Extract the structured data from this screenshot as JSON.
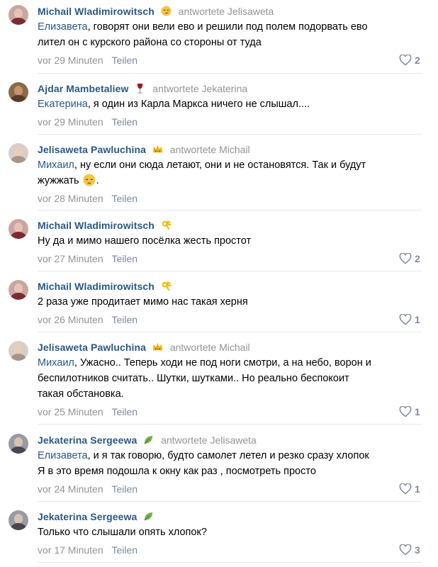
{
  "comments": [
    {
      "author": "Michail Wladimirowitsch",
      "emoji": "smirk-emoji",
      "reply_to": "antwortete Jelisaweta",
      "addressee": "Елизавета",
      "line1": ", говорят они вели ево и решили под полем подорвать ево",
      "line2": "лител он с курского района со стороны от туда",
      "time": "vor 29 Minuten",
      "share": "Teilen",
      "likes": "2"
    },
    {
      "author": "Ajdar Mambetaliew",
      "emoji": "wine-glass-emoji",
      "reply_to": "antwortete Jekaterina",
      "addressee": "Екатерина",
      "line1": ", я один из Карла Маркса ничего не слышал....",
      "time": "vor 29 Minuten",
      "share": "Teilen",
      "likes": ""
    },
    {
      "author": "Jelisaweta Pawluchina",
      "emoji": "crown-emoji",
      "reply_to": "antwortete Michail",
      "addressee": "Михаил",
      "line1": ", ну если они сюда летают, они и не остановятся. Так и будут",
      "line2": "жужжать",
      "line2_end": ".",
      "time": "vor 28 Minuten",
      "share": "Teilen",
      "likes": ""
    },
    {
      "author": "Michail Wladimirowitsch",
      "emoji": "ok-hand-emoji",
      "line1": "Ну да и мимо нашего посёлка жесть простот",
      "time": "vor 27 Minuten",
      "share": "Teilen",
      "likes": "2"
    },
    {
      "author": "Michail Wladimirowitsch",
      "emoji": "ok-hand-emoji",
      "line1": "2 раза уже продитает мимо нас такая херня",
      "time": "vor 26 Minuten",
      "share": "Teilen",
      "likes": "1"
    },
    {
      "author": "Jelisaweta Pawluchina",
      "emoji": "crown-emoji",
      "reply_to": "antwortete Michail",
      "addressee": "Михаил",
      "line1": ", Ужасно.. Теперь ходи не под ноги смотри, а на небо, ворон и",
      "line2": "беспилотников считать.. Шутки, шутками.. Но реально беспокоит",
      "line3": "такая обстановка.",
      "time": "vor 25 Minuten",
      "share": "Teilen",
      "likes": "1"
    },
    {
      "author": "Jekaterina Sergeewa",
      "emoji": "leaf-emoji",
      "reply_to": "antwortete Jelisaweta",
      "addressee": "Елизавета",
      "line1": ", и я так говорю, будто самолет летел и резко сразу хлопок",
      "line2": "Я в это время подошла к окну как раз , посмотреть просто",
      "time": "vor 24 Minuten",
      "share": "Teilen",
      "likes": "1"
    },
    {
      "author": "Jekaterina Sergeewa",
      "emoji": "leaf-emoji",
      "line1": "Только что слышали опять хлопок?",
      "time": "vor 17 Minuten",
      "share": "Teilen",
      "likes": "3"
    }
  ],
  "colors": {
    "author": "#2a5885",
    "meta": "#939393",
    "divider": "#e7e8ec"
  }
}
